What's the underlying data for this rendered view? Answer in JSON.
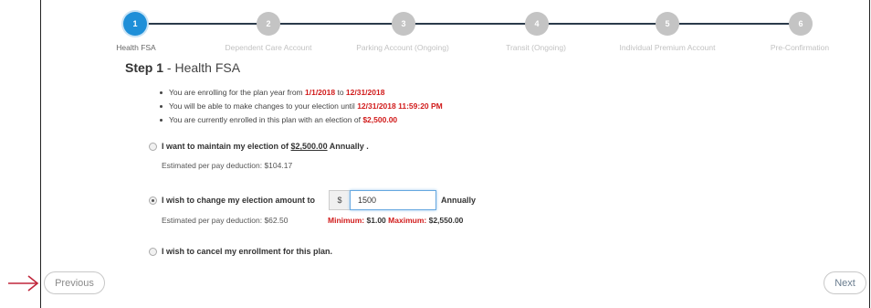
{
  "steps": [
    {
      "number": "1",
      "label": "Health FSA",
      "active": true
    },
    {
      "number": "2",
      "label": "Dependent Care Account",
      "active": false
    },
    {
      "number": "3",
      "label": "Parking Account (Ongoing)",
      "active": false
    },
    {
      "number": "4",
      "label": "Transit (Ongoing)",
      "active": false
    },
    {
      "number": "5",
      "label": "Individual Premium Account",
      "active": false
    },
    {
      "number": "6",
      "label": "Pre-Confirmation",
      "active": false
    }
  ],
  "title": {
    "step": "Step 1",
    "separator": " - ",
    "name": "Health FSA"
  },
  "bullets": [
    {
      "pre": "You are enrolling for the plan year from ",
      "v1": "1/1/2018",
      "mid": " to ",
      "v2": "12/31/2018"
    },
    {
      "pre": "You will be able to make changes to your election until ",
      "v1": "12/31/2018 11:59:20 PM"
    },
    {
      "pre": "You are currently enrolled in this plan with an election of ",
      "v1": "$2,500.00"
    }
  ],
  "option_maintain": {
    "pre": "I want to maintain my election of ",
    "amount": "$2,500.00",
    "post": " Annually .",
    "estimate": "Estimated per pay deduction: $104.17",
    "selected": false
  },
  "option_change": {
    "label": "I wish to change my election amount to",
    "currency": "$",
    "value": "1500",
    "annually": "Annually",
    "estimate": "Estimated per pay deduction: $62.50",
    "min_label": "Minimum:",
    "min_value": "$1.00",
    "max_label": "Maximum:",
    "max_value": "$2,550.00",
    "selected": true
  },
  "option_cancel": {
    "label": "I wish to cancel my enrollment for this plan.",
    "selected": false
  },
  "buttons": {
    "previous": "Previous",
    "next": "Next"
  },
  "colors": {
    "active_step": "#1e8fd8",
    "inactive_step": "#c4c4c4",
    "highlight": "#d11b1b",
    "arrow": "#c0263b"
  },
  "icons": {
    "pointer": "arrow-right-icon"
  }
}
